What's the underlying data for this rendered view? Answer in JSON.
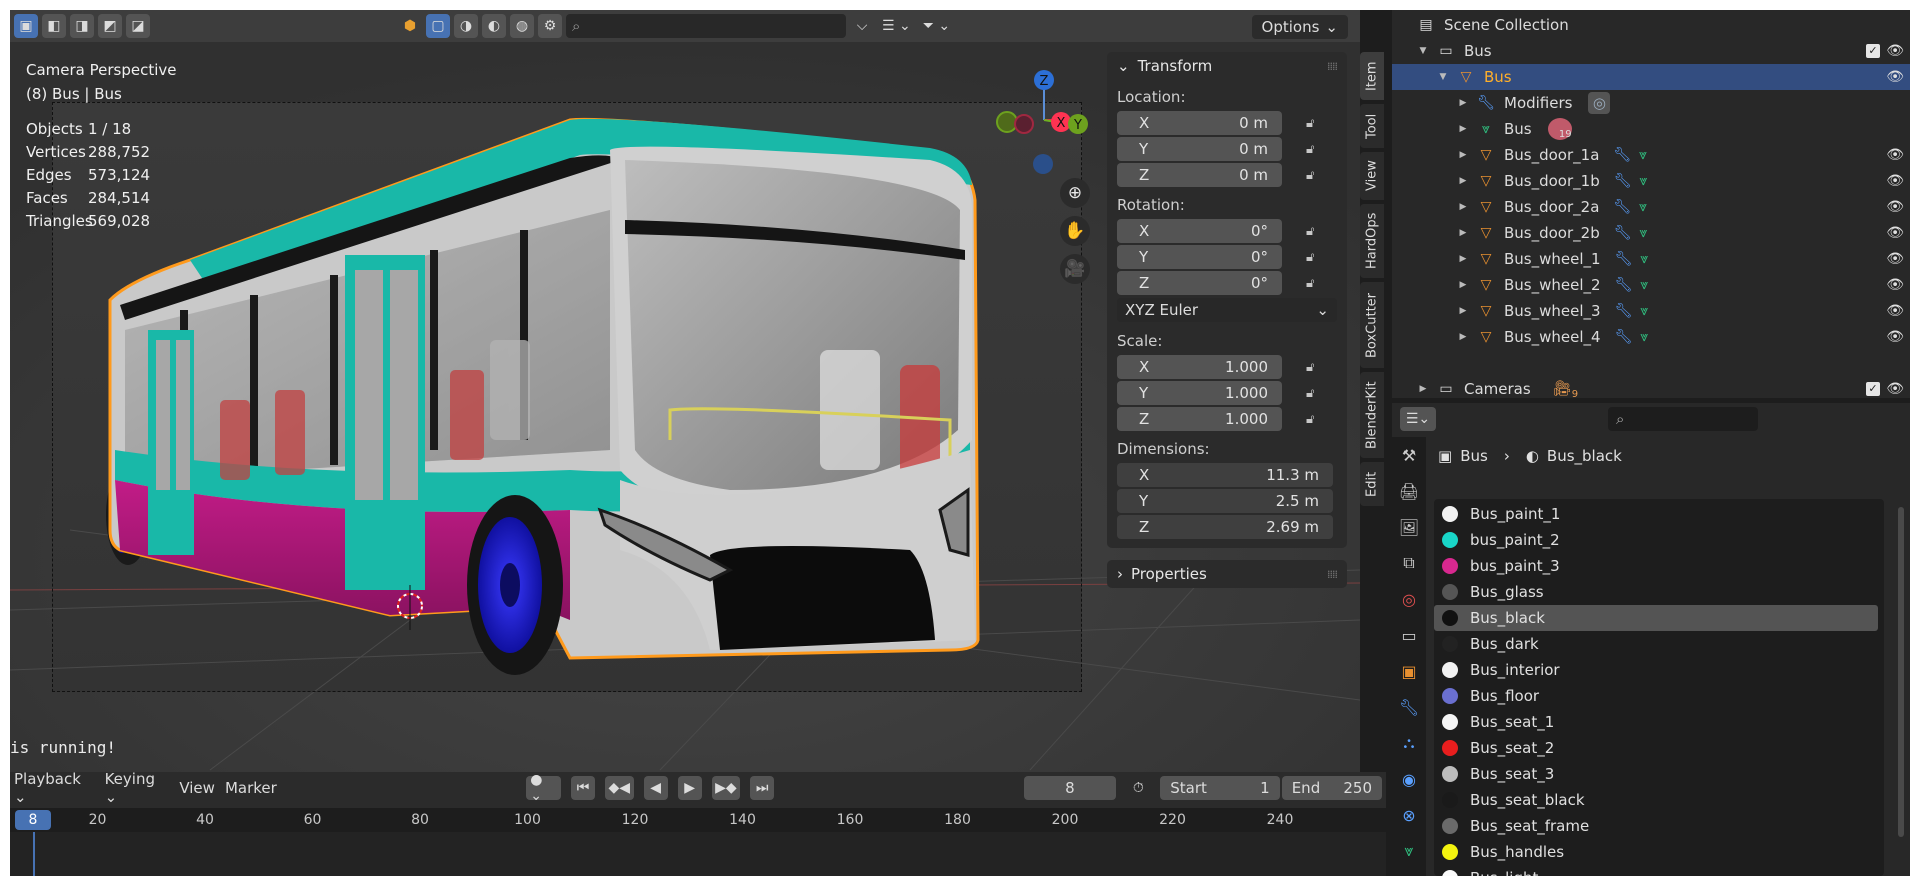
{
  "viewport": {
    "header": {
      "search_placeholder": "",
      "options_label": "Options"
    },
    "overlay": {
      "view_name": "Camera Perspective",
      "collection_label": "(8) Bus | Bus"
    },
    "stats": [
      {
        "label": "Objects",
        "value": "1 / 18"
      },
      {
        "label": "Vertices",
        "value": "288,752"
      },
      {
        "label": "Edges",
        "value": "573,124"
      },
      {
        "label": "Faces",
        "value": "284,514"
      },
      {
        "label": "Triangles",
        "value": "569,028"
      }
    ],
    "status_text": "is running!",
    "gizmo": {
      "x": "X",
      "y": "Y",
      "z": "Z"
    }
  },
  "npanel": {
    "transform_title": "Transform",
    "location_label": "Location:",
    "location": [
      {
        "axis": "X",
        "value": "0 m"
      },
      {
        "axis": "Y",
        "value": "0 m"
      },
      {
        "axis": "Z",
        "value": "0 m"
      }
    ],
    "rotation_label": "Rotation:",
    "rotation": [
      {
        "axis": "X",
        "value": "0°"
      },
      {
        "axis": "Y",
        "value": "0°"
      },
      {
        "axis": "Z",
        "value": "0°"
      }
    ],
    "rotation_mode": "XYZ Euler",
    "scale_label": "Scale:",
    "scale": [
      {
        "axis": "X",
        "value": "1.000"
      },
      {
        "axis": "Y",
        "value": "1.000"
      },
      {
        "axis": "Z",
        "value": "1.000"
      }
    ],
    "dimensions_label": "Dimensions:",
    "dimensions": [
      {
        "axis": "X",
        "value": "11.3 m"
      },
      {
        "axis": "Y",
        "value": "2.5 m"
      },
      {
        "axis": "Z",
        "value": "2.69 m"
      }
    ],
    "properties_title": "Properties"
  },
  "side_tabs": [
    "Item",
    "Tool",
    "View",
    "HardOps",
    "BoxCutter",
    "BlenderKit",
    "Edit"
  ],
  "timeline": {
    "menus": [
      "Playback",
      "Keying",
      "View",
      "Marker"
    ],
    "current_frame": "8",
    "start_label": "Start",
    "start_value": "1",
    "end_label": "End",
    "end_value": "250",
    "ruler_ticks": [
      "20",
      "40",
      "60",
      "80",
      "100",
      "120",
      "140",
      "160",
      "180",
      "200",
      "220",
      "240"
    ],
    "ruler_frame_numbers": [
      20,
      40,
      60,
      80,
      100,
      120,
      140,
      160,
      180,
      200,
      220,
      240
    ],
    "frame_badge": "8"
  },
  "outliner": {
    "root": "Scene Collection",
    "collection": "Bus",
    "selected_object": "Bus",
    "modifiers_label": "Modifiers",
    "mesh_data": "Bus",
    "mesh_users": "19",
    "children": [
      "Bus_door_1a",
      "Bus_door_1b",
      "Bus_door_2a",
      "Bus_door_2b",
      "Bus_wheel_1",
      "Bus_wheel_2",
      "Bus_wheel_3",
      "Bus_wheel_4"
    ],
    "cameras_collection": "Cameras",
    "cameras_count": "9"
  },
  "properties": {
    "search_placeholder": "",
    "breadcrumb_object": "Bus",
    "breadcrumb_material": "Bus_black",
    "materials": [
      {
        "name": "Bus_paint_1",
        "color": "#f2f2f2"
      },
      {
        "name": "bus_paint_2",
        "color": "#19d6c8"
      },
      {
        "name": "bus_paint_3",
        "color": "#d8288f"
      },
      {
        "name": "Bus_glass",
        "color": "#555555"
      },
      {
        "name": "Bus_black",
        "color": "#111111"
      },
      {
        "name": "Bus_dark",
        "color": "#222222"
      },
      {
        "name": "Bus_interior",
        "color": "#f2f2f2"
      },
      {
        "name": "Bus_floor",
        "color": "#6a6fd0"
      },
      {
        "name": "Bus_seat_1",
        "color": "#f5f5f5"
      },
      {
        "name": "Bus_seat_2",
        "color": "#e81e1e"
      },
      {
        "name": "Bus_seat_3",
        "color": "#bdbdbd"
      },
      {
        "name": "Bus_seat_black",
        "color": "#1a1a1a"
      },
      {
        "name": "Bus_seat_frame",
        "color": "#6a6a6a"
      },
      {
        "name": "Bus_handles",
        "color": "#f4f40f"
      },
      {
        "name": "Bus_light",
        "color": "#fafafa"
      }
    ],
    "selected_material": "Bus_black"
  },
  "colors": {
    "accent": "#4772b3",
    "selection_orange": "#ffaf29",
    "bus_teal": "#19b8a8",
    "bus_magenta": "#b0187a"
  }
}
